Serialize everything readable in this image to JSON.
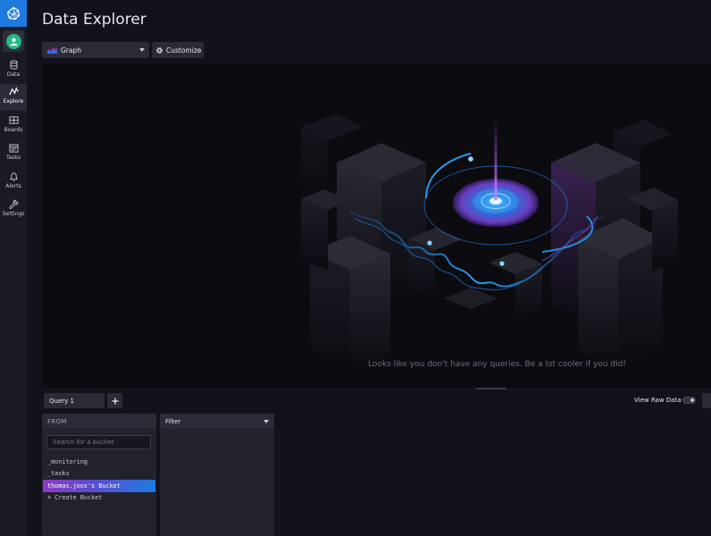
{
  "page": {
    "title": "Data Explorer"
  },
  "sidebar": {
    "logo_icon": "influxdb-logo-icon",
    "avatar_icon": "user-avatar-icon",
    "items": [
      {
        "label": "Data",
        "icon": "database-icon",
        "active": false
      },
      {
        "label": "Explore",
        "icon": "graph-line-icon",
        "active": true
      },
      {
        "label": "Boards",
        "icon": "dashboard-icon",
        "active": false
      },
      {
        "label": "Tasks",
        "icon": "calendar-icon",
        "active": false
      },
      {
        "label": "Alerts",
        "icon": "bell-icon",
        "active": false
      },
      {
        "label": "Settings",
        "icon": "wrench-icon",
        "active": false
      }
    ]
  },
  "toolbar": {
    "visualization": "Graph",
    "customize_label": "Customize"
  },
  "graph_panel": {
    "empty_message": "Looks like you don't have any queries. Be a lot cooler if you did!"
  },
  "query_bar": {
    "tabs": [
      {
        "label": "Query 1"
      }
    ],
    "add_icon": "plus-icon",
    "view_raw_label": "View Raw Data",
    "view_raw_enabled": false
  },
  "builder": {
    "from": {
      "header": "FROM",
      "search_placeholder": "Search for a bucket",
      "buckets": [
        "_monitoring",
        "_tasks",
        "thomas.joos's Bucket"
      ],
      "selected": "thomas.joos's Bucket",
      "create_label": "+ Create Bucket"
    },
    "filter": {
      "header": "Filter"
    }
  },
  "colors": {
    "accent_blue": "#1f7ae0",
    "accent_purple": "#8d3bc2",
    "avatar_green": "#25b986"
  }
}
